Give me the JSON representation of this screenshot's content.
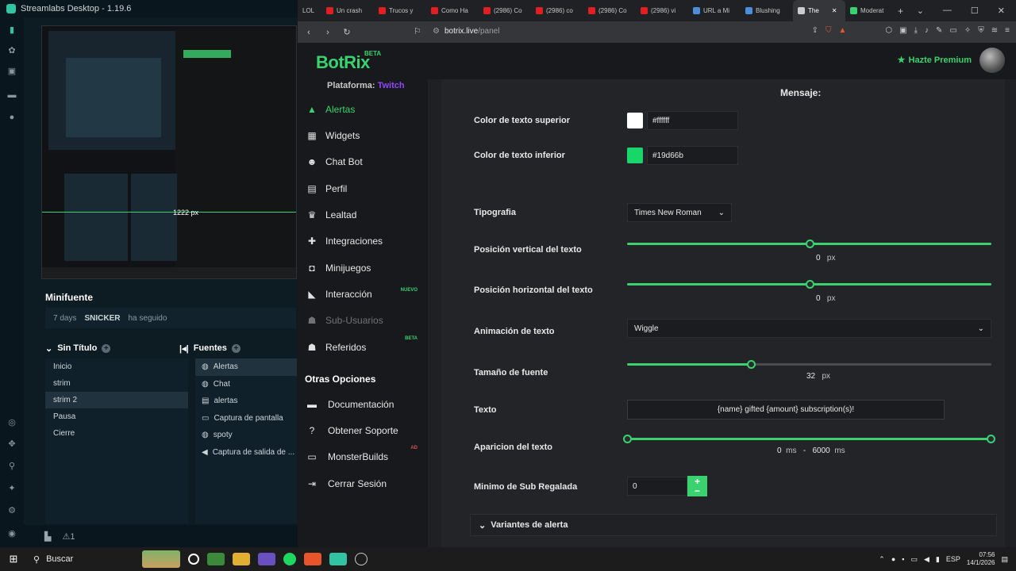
{
  "streamlabs": {
    "title": "Streamlabs Desktop - 1.19.6",
    "preview_overlay": "1222 px",
    "minifuente_title": "Minifuente",
    "event": {
      "age": "7 days",
      "user": "SNICKER",
      "action": "ha seguido"
    },
    "scenes_title": "Sin Título",
    "scenes": [
      "Inicio",
      "strim",
      "strim 2",
      "Pausa",
      "Cierre"
    ],
    "sources_title": "Fuentes",
    "sources": [
      "Alertas",
      "Chat",
      "alertas",
      "Captura de pantalla",
      "spoty",
      "Captura de salida de ..."
    ],
    "footer_badge": "1"
  },
  "browser": {
    "tabs": [
      {
        "label": "LOL",
        "color": "#555"
      },
      {
        "label": "Un crash",
        "color": "#e02020"
      },
      {
        "label": "Trucos y",
        "color": "#e02020"
      },
      {
        "label": "Como Ha",
        "color": "#e02020"
      },
      {
        "label": "(2986) Co",
        "color": "#e02020"
      },
      {
        "label": "(2986) co",
        "color": "#e02020"
      },
      {
        "label": "(2986) Co",
        "color": "#e02020"
      },
      {
        "label": "(2986) vi",
        "color": "#e02020"
      },
      {
        "label": "URL a Mi",
        "color": "#4a8fd8"
      },
      {
        "label": "Blushing",
        "color": "#4a8fd8"
      },
      {
        "label": "The",
        "color": "#ccc"
      },
      {
        "label": "Moderat",
        "color": "#3ad26e"
      }
    ],
    "url_host": "botrix.live",
    "url_path": "/panel"
  },
  "botrix": {
    "logo": "BotRix",
    "beta": "BETA",
    "premium": "Hazte Premium",
    "platform_label": "Plataforma:",
    "platform_value": "Twitch",
    "nav": [
      {
        "label": "Alertas",
        "icon": "warning-icon"
      },
      {
        "label": "Widgets",
        "icon": "grid-icon"
      },
      {
        "label": "Chat Bot",
        "icon": "robot-icon"
      },
      {
        "label": "Perfil",
        "icon": "id-card-icon"
      },
      {
        "label": "Lealtad",
        "icon": "trophy-icon"
      },
      {
        "label": "Integraciones",
        "icon": "puzzle-icon"
      },
      {
        "label": "Minijuegos",
        "icon": "gamepad-icon"
      },
      {
        "label": "Interacción",
        "icon": "megaphone-icon",
        "badge": "NUEVO"
      },
      {
        "label": "Sub-Usuarios",
        "icon": "users-icon"
      },
      {
        "label": "Referidos",
        "icon": "referral-icon",
        "badge": "BETA"
      }
    ],
    "other_title": "Otras Opciones",
    "other": [
      {
        "label": "Documentación",
        "icon": "book-icon"
      },
      {
        "label": "Obtener Soporte",
        "icon": "help-icon"
      },
      {
        "label": "MonsterBuilds",
        "icon": "monitor-icon",
        "badge": "AD"
      },
      {
        "label": "Cerrar Sesión",
        "icon": "logout-icon"
      }
    ]
  },
  "form": {
    "message_title": "Mensaje:",
    "top_color_label": "Color de texto superior",
    "top_color_value": "#ffffff",
    "bottom_color_label": "Color de texto inferior",
    "bottom_color_value": "#19d66b",
    "typography_label": "Tipografia",
    "typography_value": "Times New Roman",
    "vpos_label": "Posición vertical del texto",
    "vpos_value": "0",
    "vpos_level": 0.5,
    "hpos_label": "Posición horizontal del texto",
    "hpos_value": "0",
    "hpos_level": 0.5,
    "unit_px": "px",
    "animation_label": "Animación de texto",
    "animation_value": "Wiggle",
    "fontsize_label": "Tamaño de fuente",
    "fontsize_value": "32",
    "fontsize_level": 0.34,
    "text_label": "Texto",
    "text_value": "{name} gifted {amount} subscription(s)!",
    "appear_label": "Aparicion del texto",
    "appear_min": "0",
    "appear_max": "6000",
    "unit_ms": "ms",
    "appear_sep": "-",
    "min_sub_label": "Minimo de Sub Regalada",
    "min_sub_value": "0",
    "variants_label": "Variantes de alerta"
  },
  "taskbar": {
    "search": "Buscar",
    "lang": "ESP",
    "time": "07:56",
    "date": "14/1/2026"
  }
}
